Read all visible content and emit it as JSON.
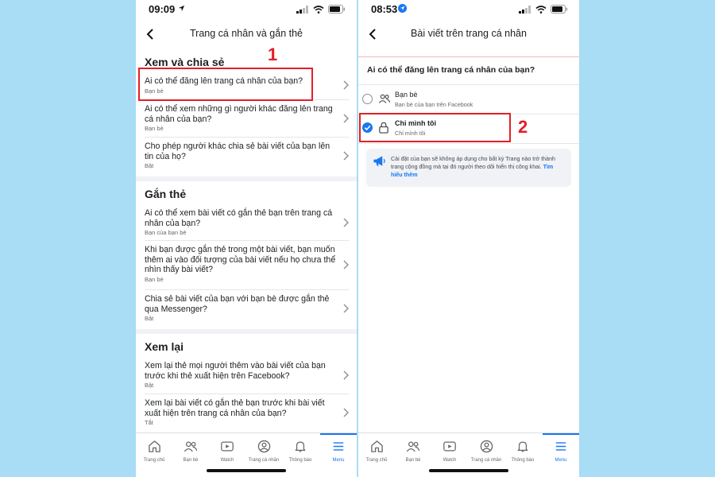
{
  "left": {
    "status": {
      "time": "09:09"
    },
    "title": "Trang cá nhân và gắn thẻ",
    "sections": [
      {
        "title": "Xem và chia sẻ",
        "items": [
          {
            "title": "Ai có thể đăng lên trang cá nhân của bạn?",
            "sub": "Bạn bè"
          },
          {
            "title": "Ai có thể xem những gì người khác đăng lên trang cá nhân của bạn?",
            "sub": "Bạn bè"
          },
          {
            "title": "Cho phép người khác chia sẻ bài viết của bạn lên tin của họ?",
            "sub": "Bật"
          }
        ]
      },
      {
        "title": "Gắn thẻ",
        "items": [
          {
            "title": "Ai có thể xem bài viết có gắn thẻ bạn trên trang cá nhân của bạn?",
            "sub": "Bạn của bạn bè"
          },
          {
            "title": "Khi bạn được gắn thẻ trong một bài viết, bạn muốn thêm ai vào đối tượng của bài viết nếu họ chưa thể nhìn thấy bài viết?",
            "sub": "Bạn bè"
          },
          {
            "title": "Chia sẻ bài viết của bạn với bạn bè được gắn thẻ qua Messenger?",
            "sub": "Bật"
          }
        ]
      },
      {
        "title": "Xem lại",
        "items": [
          {
            "title": "Xem lại thẻ mọi người thêm vào bài viết của bạn trước khi thẻ xuất hiện trên Facebook?",
            "sub": "Bật"
          },
          {
            "title": "Xem lại bài viết có gắn thẻ bạn trước khi bài viết xuất hiện trên trang cá nhân của bạn?",
            "sub": "Tắt"
          }
        ]
      }
    ],
    "annotation_number": "1"
  },
  "right": {
    "status": {
      "time": "08:53"
    },
    "title": "Bài viết trên trang cá nhân",
    "question": "Ai có thể đăng lên trang cá nhân của bạn?",
    "options": [
      {
        "title": "Bạn bè",
        "sub": "Bạn bè của bạn trên Facebook",
        "selected": false,
        "icon": "friends-icon"
      },
      {
        "title": "Chỉ mình tôi",
        "sub": "Chỉ mình tôi",
        "selected": true,
        "icon": "lock-icon"
      }
    ],
    "info": {
      "text": "Cài đặt của bạn sẽ không áp dụng cho bất kỳ Trang nào trở thành trang cộng đồng mà tại đó người theo dõi hiển thị công khai.",
      "link": "Tìm hiểu thêm"
    },
    "annotation_number": "2"
  },
  "tabs": [
    {
      "label": "Trang chủ",
      "icon": "home-icon"
    },
    {
      "label": "Bạn bè",
      "icon": "friends-icon"
    },
    {
      "label": "Watch",
      "icon": "watch-icon"
    },
    {
      "label": "Trang cá nhân",
      "icon": "profile-icon"
    },
    {
      "label": "Thông báo",
      "icon": "bell-icon"
    },
    {
      "label": "Menu",
      "icon": "menu-icon",
      "active": true
    }
  ],
  "colors": {
    "accent": "#1877f2",
    "annotation": "#e21f26",
    "background": "#a9dcf5"
  }
}
